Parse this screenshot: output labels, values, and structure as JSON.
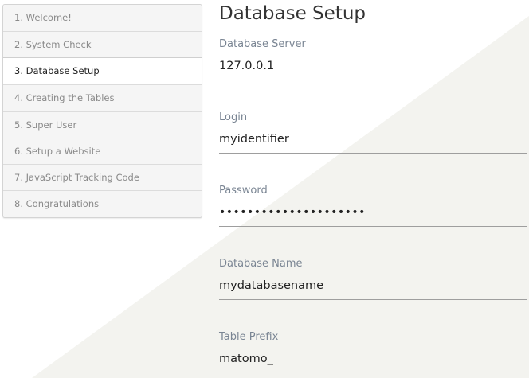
{
  "steps": [
    {
      "label": "1. Welcome!",
      "active": false
    },
    {
      "label": "2. System Check",
      "active": false
    },
    {
      "label": "3. Database Setup",
      "active": true
    },
    {
      "label": "4. Creating the Tables",
      "active": false
    },
    {
      "label": "5. Super User",
      "active": false
    },
    {
      "label": "6. Setup a Website",
      "active": false
    },
    {
      "label": "7. JavaScript Tracking Code",
      "active": false
    },
    {
      "label": "8. Congratulations",
      "active": false
    }
  ],
  "page": {
    "title": "Database Setup"
  },
  "form": {
    "server": {
      "label": "Database Server",
      "value": "127.0.0.1"
    },
    "login": {
      "label": "Login",
      "value": "myidentifier"
    },
    "password": {
      "label": "Password",
      "value": "•••••••••••••••••••••"
    },
    "dbname": {
      "label": "Database Name",
      "value": "mydatabasename"
    },
    "prefix": {
      "label": "Table Prefix",
      "value": "matomo_"
    }
  },
  "colors": {
    "background_triangle": "#f2f2ee",
    "label": "#7a8593",
    "active_step": "#ffffff",
    "inactive_step": "#f5f5f5"
  }
}
